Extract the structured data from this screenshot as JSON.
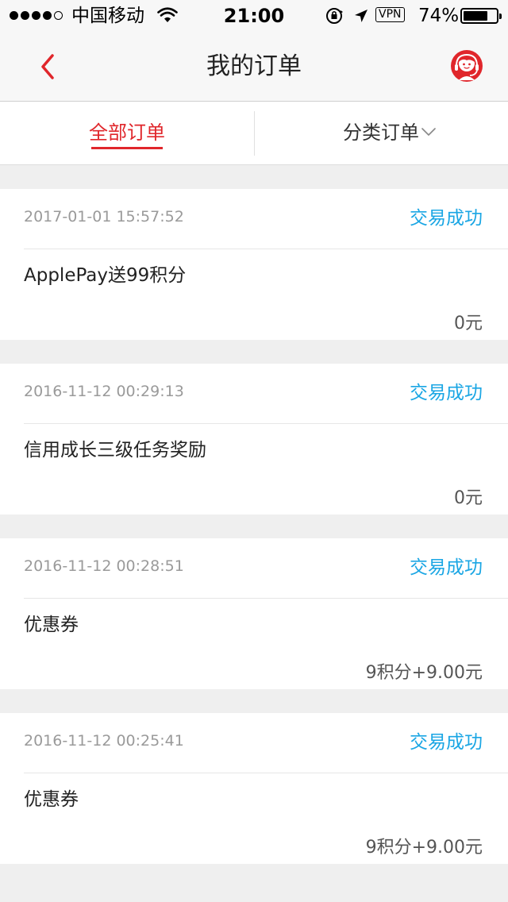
{
  "status_bar": {
    "carrier": "中国移动",
    "time": "21:00",
    "vpn_label": "VPN",
    "battery_percent_text": "74%",
    "battery_level": 0.74,
    "signal_bars_filled": 4,
    "signal_bars_total": 5
  },
  "nav": {
    "title": "我的订单",
    "back_icon": "chevron-left-icon",
    "service_icon": "customer-service-icon",
    "accent_color": "#e0262b"
  },
  "tabs": {
    "all_label": "全部订单",
    "category_label": "分类订单",
    "active_color": "#e0262b"
  },
  "orders": [
    {
      "time": "2017-01-01 15:57:52",
      "status": "交易成功",
      "title": "ApplePay送99积分",
      "amount": "0元"
    },
    {
      "time": "2016-11-12 00:29:13",
      "status": "交易成功",
      "title": "信用成长三级任务奖励",
      "amount": "0元"
    },
    {
      "time": "2016-11-12 00:28:51",
      "status": "交易成功",
      "title": "优惠券",
      "amount": "9积分+9.00元"
    },
    {
      "time": "2016-11-12 00:25:41",
      "status": "交易成功",
      "title": "优惠券",
      "amount": "9积分+9.00元"
    }
  ],
  "status_color": "#1aa6e4"
}
